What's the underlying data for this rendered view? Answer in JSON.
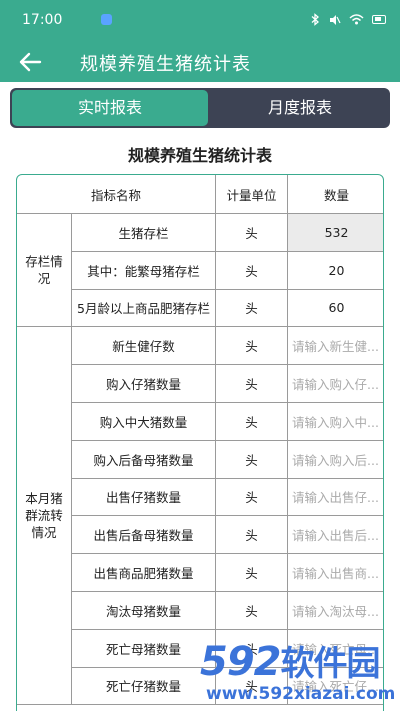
{
  "status_bar": {
    "time": "17:00",
    "icons": [
      "bluetooth-icon",
      "mute-icon",
      "wifi-icon",
      "battery-icon"
    ]
  },
  "header": {
    "title": "规模养殖生猪统计表",
    "back_icon": "back-arrow-icon"
  },
  "tabs": [
    {
      "label": "实时报表",
      "active": true
    },
    {
      "label": "月度报表",
      "active": false
    }
  ],
  "table": {
    "title": "规模养殖生猪统计表",
    "headers": [
      "指标名称",
      "计量单位",
      "数量"
    ],
    "groups": [
      {
        "label": "存栏情况",
        "rows": [
          {
            "name": "生猪存栏",
            "unit": "头",
            "value": "532",
            "placeholder": ""
          },
          {
            "name": "其中：能繁母猪存栏",
            "unit": "头",
            "value": "20",
            "placeholder": ""
          },
          {
            "name": "5月龄以上商品肥猪存栏",
            "unit": "头",
            "value": "60",
            "placeholder": ""
          }
        ]
      },
      {
        "label": "本月猪群流转情况",
        "rows": [
          {
            "name": "新生健仔数",
            "unit": "头",
            "value": "",
            "placeholder": "请输入新生健..."
          },
          {
            "name": "购入仔猪数量",
            "unit": "头",
            "value": "",
            "placeholder": "请输入购入仔..."
          },
          {
            "name": "购入中大猪数量",
            "unit": "头",
            "value": "",
            "placeholder": "请输入购入中..."
          },
          {
            "name": "购入后备母猪数量",
            "unit": "头",
            "value": "",
            "placeholder": "请输入购入后..."
          },
          {
            "name": "出售仔猪数量",
            "unit": "头",
            "value": "",
            "placeholder": "请输入出售仔..."
          },
          {
            "name": "出售后备母猪数量",
            "unit": "头",
            "value": "",
            "placeholder": "请输入出售后..."
          },
          {
            "name": "出售商品肥猪数量",
            "unit": "头",
            "value": "",
            "placeholder": "请输入出售商..."
          },
          {
            "name": "淘汰母猪数量",
            "unit": "头",
            "value": "",
            "placeholder": "请输入淘汰母..."
          },
          {
            "name": "死亡母猪数量",
            "unit": "头",
            "value": "",
            "placeholder": "请输入死亡母..."
          },
          {
            "name": "死亡仔猪数量",
            "unit": "头",
            "value": "",
            "placeholder": "请输入死亡仔..."
          }
        ]
      }
    ]
  },
  "watermark": {
    "brand_digits": "592",
    "brand_text": "软件园",
    "url": "www.592xiazai.com"
  },
  "colors": {
    "primary": "#3aab8f",
    "segment_bg": "#3d4354",
    "border": "#9a9a9a",
    "watermark": "#3b73d9"
  }
}
